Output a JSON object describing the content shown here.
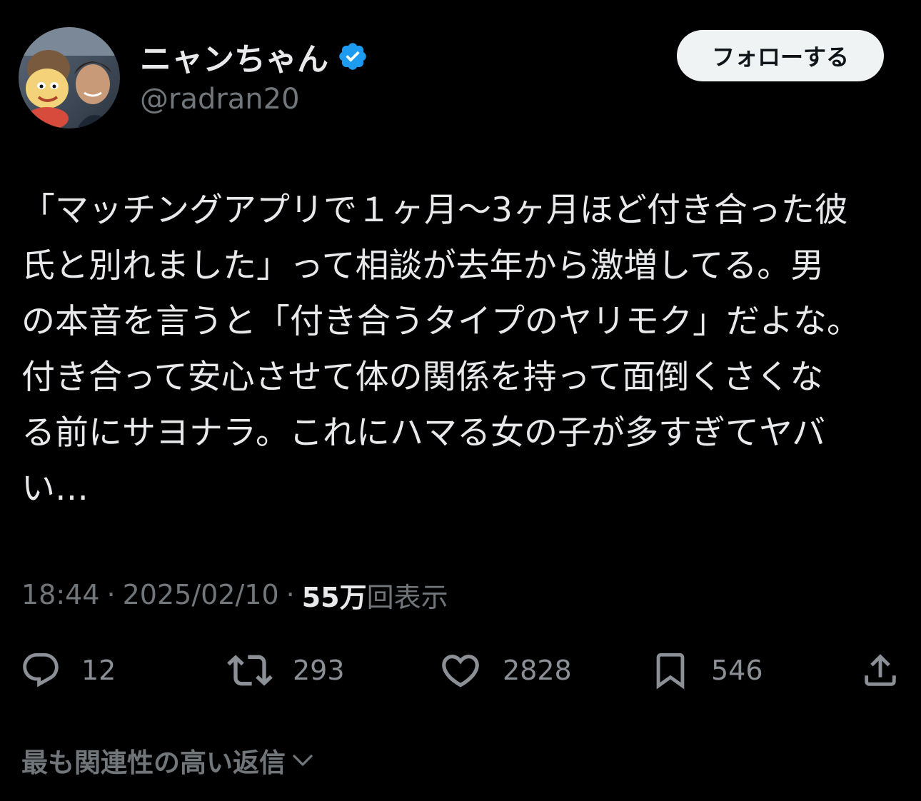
{
  "author": {
    "display_name": "ニャンちゃん",
    "handle": "@radran20",
    "verified": true
  },
  "follow_button": {
    "label": "フォローする"
  },
  "tweet": {
    "text_lines": [
      "「マッチングアプリで１ヶ月〜3ヶ月ほど付き合った彼",
      "氏と別れました」って相談が去年から激増してる。男",
      "の本音を言うと「付き合うタイプのヤリモク」だよな。",
      "付き合って安心させて体の関係を持って面倒くさくな",
      "る前にサヨナラ。これにハマる女の子が多すぎてヤバ",
      "い…"
    ],
    "time": "18:44",
    "separator": "·",
    "date": "2025/02/10",
    "views_count": "55万",
    "views_label": "回表示"
  },
  "actions": {
    "reply": {
      "icon": "reply-icon",
      "count": "12"
    },
    "retweet": {
      "icon": "retweet-icon",
      "count": "293"
    },
    "like": {
      "icon": "heart-icon",
      "count": "2828"
    },
    "bookmark": {
      "icon": "bookmark-icon",
      "count": "546"
    },
    "share": {
      "icon": "share-icon"
    }
  },
  "replies_sort": {
    "label": "最も関連性の高い返信",
    "icon": "chevron-down-icon"
  },
  "colors": {
    "background": "#000000",
    "primary_text": "#e7e9ea",
    "secondary_text": "#71767b",
    "verified_badge": "#1d9bf0",
    "follow_button_bg": "#eff3f4"
  }
}
